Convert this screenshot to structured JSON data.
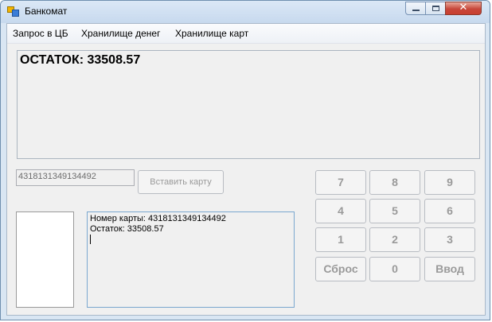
{
  "window": {
    "title": "Банкомат",
    "close_glyph": "✕"
  },
  "menu": {
    "items": [
      "Запрос в ЦБ",
      "Хранилище денег",
      "Хранилище карт"
    ]
  },
  "balance": {
    "text": "ОСТАТОК: 33508.57"
  },
  "card": {
    "number_value": "4318131349134492",
    "insert_button": "Вставить карту"
  },
  "log": {
    "lines": [
      "Номер карты: 4318131349134492",
      "Остаток: 33508.57"
    ]
  },
  "keypad": {
    "keys": [
      "7",
      "8",
      "9",
      "4",
      "5",
      "6",
      "1",
      "2",
      "3",
      "Сброс",
      "0",
      "Ввод"
    ]
  }
}
